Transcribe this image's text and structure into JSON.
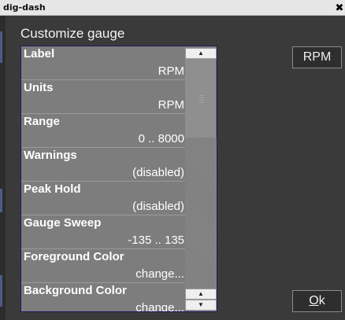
{
  "window": {
    "title": "dig-dash",
    "close_glyph": "✖"
  },
  "dialog": {
    "title": "Customize gauge"
  },
  "list": {
    "items": [
      {
        "label": "Label",
        "value": "RPM"
      },
      {
        "label": "Units",
        "value": "RPM"
      },
      {
        "label": "Range",
        "value": "0 .. 8000"
      },
      {
        "label": "Warnings",
        "value": "(disabled)"
      },
      {
        "label": "Peak Hold",
        "value": "(disabled)"
      },
      {
        "label": "Gauge Sweep",
        "value": "-135 .. 135"
      },
      {
        "label": "Foreground Color",
        "value": "change..."
      },
      {
        "label": "Background Color",
        "value": "change..."
      }
    ]
  },
  "scrollbar": {
    "up_glyph": "▲",
    "down_glyph": "▼"
  },
  "buttons": {
    "preview_label": "RPM",
    "ok_mnemonic": "O",
    "ok_rest": "k"
  },
  "colors": {
    "list_bg": "#7d7d7d",
    "list_border": "#1a1a60",
    "window_bg": "#3a3a3a"
  }
}
